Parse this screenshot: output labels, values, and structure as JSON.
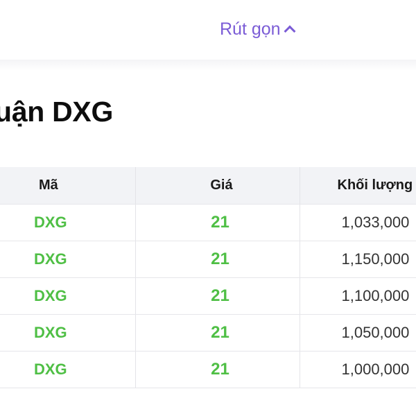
{
  "collapse": {
    "label": "Rút gọn",
    "icon": "chevron-up-icon"
  },
  "section": {
    "title": "uận DXG"
  },
  "table": {
    "headers": [
      "Mã",
      "Giá",
      "Khối lượng"
    ],
    "rows": [
      {
        "code": "DXG",
        "price": "21",
        "volume": "1,033,000"
      },
      {
        "code": "DXG",
        "price": "21",
        "volume": "1,150,000"
      },
      {
        "code": "DXG",
        "price": "21",
        "volume": "1,100,000"
      },
      {
        "code": "DXG",
        "price": "21",
        "volume": "1,050,000"
      },
      {
        "code": "DXG",
        "price": "21",
        "volume": "1,000,000"
      }
    ]
  },
  "colors": {
    "accent": "#7b5cd6",
    "positive": "#4fbf45",
    "header_bg": "#f2f3f6"
  }
}
